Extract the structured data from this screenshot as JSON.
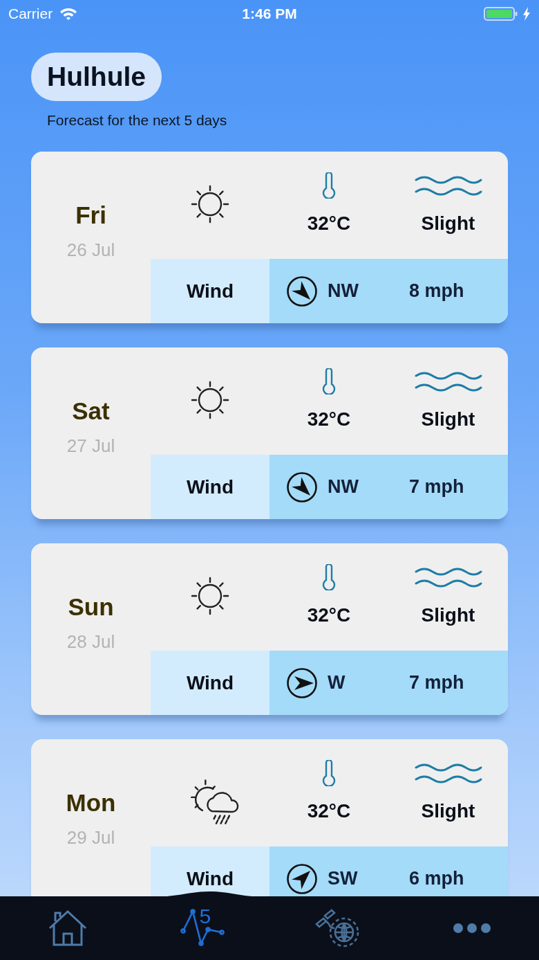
{
  "status_bar": {
    "carrier": "Carrier",
    "time": "1:46 PM"
  },
  "header": {
    "location": "Hulhule",
    "subtitle": "Forecast for the next 5 days"
  },
  "days": [
    {
      "kind": "sunny",
      "day": "Fri",
      "date": "26 Jul",
      "temperature": "32°C",
      "sea": "Slight",
      "wind": {
        "kind": "southeast",
        "label": "Wind",
        "direction": "NW",
        "speed": "8 mph"
      }
    },
    {
      "kind": "sunny",
      "day": "Sat",
      "date": "27 Jul",
      "temperature": "32°C",
      "sea": "Slight",
      "wind": {
        "kind": "southeast",
        "label": "Wind",
        "direction": "NW",
        "speed": "7 mph"
      }
    },
    {
      "kind": "sunny",
      "day": "Sun",
      "date": "28 Jul",
      "temperature": "32°C",
      "sea": "Slight",
      "wind": {
        "kind": "east",
        "label": "Wind",
        "direction": "W",
        "speed": "7 mph"
      }
    },
    {
      "kind": "sun-rain",
      "day": "Mon",
      "date": "29 Jul",
      "temperature": "32°C",
      "sea": "Slight",
      "wind": {
        "kind": "northeast",
        "label": "Wind",
        "direction": "SW",
        "speed": "6 mph"
      }
    }
  ],
  "tab_bar": [
    {
      "kind": "home",
      "selected": false
    },
    {
      "kind": "forecast",
      "label": "5",
      "selected": true
    },
    {
      "kind": "satellite",
      "selected": false
    },
    {
      "kind": "more",
      "selected": false
    }
  ]
}
